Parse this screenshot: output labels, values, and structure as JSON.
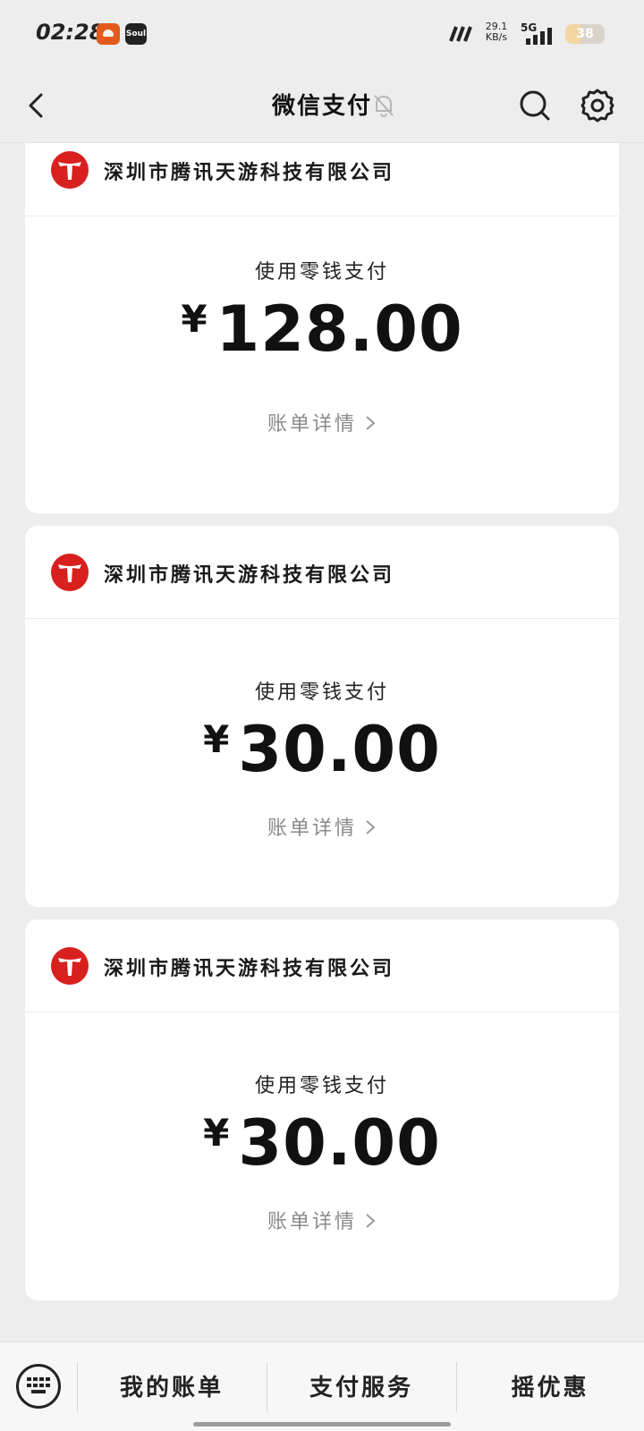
{
  "status_bar": {
    "time": "02:28",
    "app_icon_2_label": "Soul",
    "net_speed_value": "29.1",
    "net_speed_unit": "KB/s",
    "network": "5G",
    "battery": "38",
    "battery_level": 0.38
  },
  "nav": {
    "title": "微信支付",
    "back_icon": "chevron-left-icon",
    "mute_icon": "bell-off-icon",
    "search_icon": "search-icon",
    "settings_icon": "gear-icon"
  },
  "payments": [
    {
      "merchant": "深圳市腾讯天游科技有限公司",
      "method": "使用零钱支付",
      "currency": "¥",
      "amount": "128.00",
      "detail_label": "账单详情"
    },
    {
      "merchant": "深圳市腾讯天游科技有限公司",
      "method": "使用零钱支付",
      "currency": "¥",
      "amount": "30.00",
      "detail_label": "账单详情"
    },
    {
      "merchant": "深圳市腾讯天游科技有限公司",
      "method": "使用零钱支付",
      "currency": "¥",
      "amount": "30.00",
      "detail_label": "账单详情"
    }
  ],
  "bottom_menu": {
    "keyboard_icon": "keyboard-icon",
    "items": [
      "我的账单",
      "支付服务",
      "摇优惠"
    ]
  },
  "colors": {
    "background": "#ededed",
    "card": "#ffffff",
    "merchant_logo_red": "#d8201f",
    "muted_text": "#8a8a8a"
  }
}
